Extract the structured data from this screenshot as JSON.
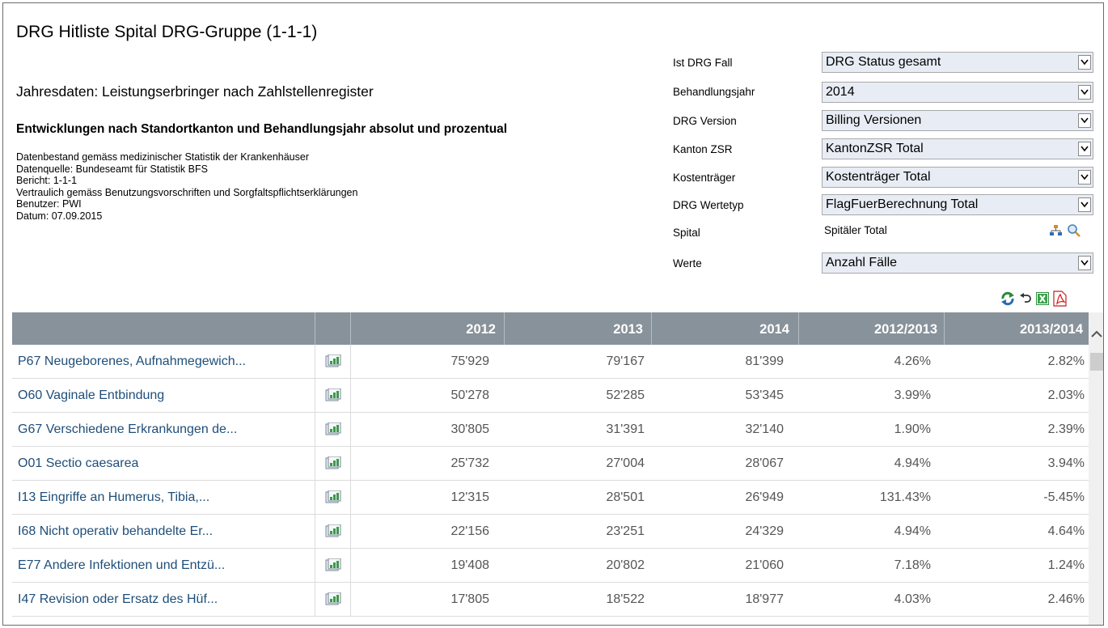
{
  "report": {
    "title": "DRG Hitliste Spital DRG-Gruppe (1-1-1)",
    "subtitle": "Jahresdaten: Leistungserbringer nach Zahlstellenregister",
    "heading": "Entwicklungen nach Standortkanton und Behandlungsjahr absolut und prozentual",
    "meta": [
      "Datenbestand gemäss medizinischer Statistik der Krankenhäuser",
      "Datenquelle: Bundeseamt für Statistik BFS",
      "Bericht: 1-1-1",
      "Vertraulich gemäss Benutzungsvorschriften und Sorgfaltspflichtserklärungen",
      "Benutzer: PWI",
      "Datum: 07.09.2015"
    ]
  },
  "filters": {
    "ist_drg_fall": {
      "label": "Ist DRG Fall",
      "value": "DRG Status gesamt"
    },
    "behandlungsjahr": {
      "label": "Behandlungsjahr",
      "value": "2014"
    },
    "drg_version": {
      "label": "DRG Version",
      "value": "Billing Versionen"
    },
    "kanton_zsr": {
      "label": "Kanton ZSR",
      "value": "KantonZSR Total"
    },
    "kostentraeger": {
      "label": "Kostenträger",
      "value": "Kostenträger Total"
    },
    "drg_wertetyp": {
      "label": "DRG Wertetyp",
      "value": "FlagFuerBerechnung Total"
    },
    "spital": {
      "label": "Spital",
      "value": "Spitäler Total"
    },
    "werte": {
      "label": "Werte",
      "value": "Anzahl Fälle"
    }
  },
  "toolbar_icons": [
    "refresh-icon",
    "undo-icon",
    "excel-icon",
    "pdf-icon"
  ],
  "table": {
    "columns": [
      "",
      "",
      "2012",
      "2013",
      "2014",
      "2012/2013",
      "2013/2014"
    ],
    "rows": [
      {
        "name": "P67 Neugeborenes, Aufnahmegewich...",
        "y2012": "75'929",
        "y2013": "79'167",
        "y2014": "81'399",
        "c1213": "4.26%",
        "c1314": "2.82%"
      },
      {
        "name": "O60 Vaginale Entbindung",
        "y2012": "50'278",
        "y2013": "52'285",
        "y2014": "53'345",
        "c1213": "3.99%",
        "c1314": "2.03%"
      },
      {
        "name": "G67 Verschiedene Erkrankungen de...",
        "y2012": "30'805",
        "y2013": "31'391",
        "y2014": "32'140",
        "c1213": "1.90%",
        "c1314": "2.39%"
      },
      {
        "name": "O01 Sectio caesarea",
        "y2012": "25'732",
        "y2013": "27'004",
        "y2014": "28'067",
        "c1213": "4.94%",
        "c1314": "3.94%"
      },
      {
        "name": "I13 Eingriffe an Humerus, Tibia,...",
        "y2012": "12'315",
        "y2013": "28'501",
        "y2014": "26'949",
        "c1213": "131.43%",
        "c1314": "-5.45%"
      },
      {
        "name": "I68 Nicht operativ behandelte Er...",
        "y2012": "22'156",
        "y2013": "23'251",
        "y2014": "24'329",
        "c1213": "4.94%",
        "c1314": "4.64%"
      },
      {
        "name": "E77 Andere Infektionen und Entzü...",
        "y2012": "19'408",
        "y2013": "20'802",
        "y2014": "21'060",
        "c1213": "7.18%",
        "c1314": "1.24%"
      },
      {
        "name": "I47 Revision oder Ersatz des Hüf...",
        "y2012": "17'805",
        "y2013": "18'522",
        "y2014": "18'977",
        "c1213": "4.03%",
        "c1314": "2.46%"
      }
    ]
  },
  "colors": {
    "header_bg": "#88929b",
    "link": "#1f4e79",
    "select_bg": "#e8edf5"
  }
}
